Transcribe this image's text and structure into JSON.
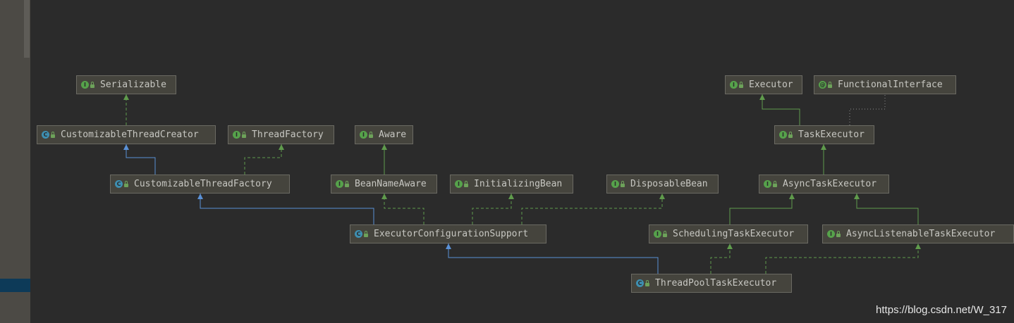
{
  "nodes": [
    {
      "id": "serializable",
      "label": "Serializable",
      "kind": "interface"
    },
    {
      "id": "customizable-thread-creator",
      "label": "CustomizableThreadCreator",
      "kind": "class"
    },
    {
      "id": "thread-factory",
      "label": "ThreadFactory",
      "kind": "interface"
    },
    {
      "id": "customizable-thread-factory",
      "label": "CustomizableThreadFactory",
      "kind": "class"
    },
    {
      "id": "aware",
      "label": "Aware",
      "kind": "interface"
    },
    {
      "id": "bean-name-aware",
      "label": "BeanNameAware",
      "kind": "interface"
    },
    {
      "id": "initializing-bean",
      "label": "InitializingBean",
      "kind": "interface"
    },
    {
      "id": "disposable-bean",
      "label": "DisposableBean",
      "kind": "interface"
    },
    {
      "id": "executor-configuration-support",
      "label": "ExecutorConfigurationSupport",
      "kind": "abstract-class"
    },
    {
      "id": "executor",
      "label": "Executor",
      "kind": "interface"
    },
    {
      "id": "functional-interface",
      "label": "FunctionalInterface",
      "kind": "annotation"
    },
    {
      "id": "task-executor",
      "label": "TaskExecutor",
      "kind": "interface"
    },
    {
      "id": "async-task-executor",
      "label": "AsyncTaskExecutor",
      "kind": "interface"
    },
    {
      "id": "scheduling-task-executor",
      "label": "SchedulingTaskExecutor",
      "kind": "interface"
    },
    {
      "id": "async-listenable-task-executor",
      "label": "AsyncListenableTaskExecutor",
      "kind": "interface"
    },
    {
      "id": "thread-pool-task-executor",
      "label": "ThreadPoolTaskExecutor",
      "kind": "class"
    }
  ],
  "edges": [
    {
      "from": "customizable-thread-creator",
      "to": "serializable",
      "type": "implements"
    },
    {
      "from": "customizable-thread-factory",
      "to": "customizable-thread-creator",
      "type": "extends"
    },
    {
      "from": "customizable-thread-factory",
      "to": "thread-factory",
      "type": "implements"
    },
    {
      "from": "bean-name-aware",
      "to": "aware",
      "type": "interface-extends"
    },
    {
      "from": "executor-configuration-support",
      "to": "customizable-thread-factory",
      "type": "extends"
    },
    {
      "from": "executor-configuration-support",
      "to": "bean-name-aware",
      "type": "implements"
    },
    {
      "from": "executor-configuration-support",
      "to": "initializing-bean",
      "type": "implements"
    },
    {
      "from": "executor-configuration-support",
      "to": "disposable-bean",
      "type": "implements"
    },
    {
      "from": "task-executor",
      "to": "executor",
      "type": "interface-extends"
    },
    {
      "from": "task-executor",
      "to": "functional-interface",
      "type": "annotated"
    },
    {
      "from": "async-task-executor",
      "to": "task-executor",
      "type": "interface-extends"
    },
    {
      "from": "scheduling-task-executor",
      "to": "async-task-executor",
      "type": "interface-extends"
    },
    {
      "from": "async-listenable-task-executor",
      "to": "async-task-executor",
      "type": "interface-extends"
    },
    {
      "from": "thread-pool-task-executor",
      "to": "executor-configuration-support",
      "type": "extends"
    },
    {
      "from": "thread-pool-task-executor",
      "to": "scheduling-task-executor",
      "type": "implements"
    },
    {
      "from": "thread-pool-task-executor",
      "to": "async-listenable-task-executor",
      "type": "implements"
    }
  ],
  "badges": {
    "interface": "I",
    "class": "C",
    "abstract-class": "C",
    "annotation": "@"
  },
  "colors": {
    "background": "#2b2b2b",
    "node_fill": "#45443d",
    "node_border": "#6b6a63",
    "text": "#c7c7c2",
    "interface_edge": "#5f9b4c",
    "class_edge": "#5a91d6",
    "annotation_edge": "#8e8e8e"
  },
  "watermark": "https://blog.csdn.net/W_317"
}
